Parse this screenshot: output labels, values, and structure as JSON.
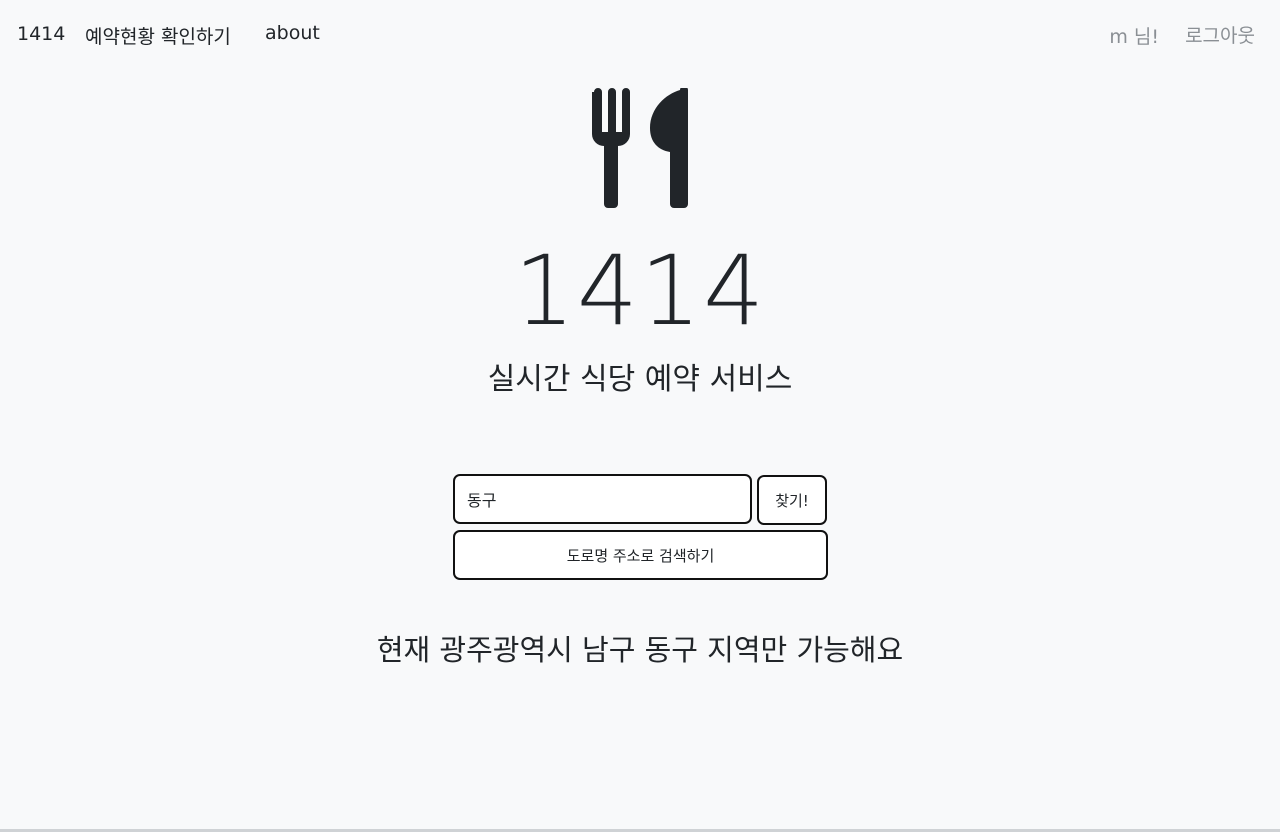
{
  "navbar": {
    "brand": "1414",
    "links": {
      "reservations": "예약현황 확인하기",
      "about": "about"
    },
    "user_greeting": "m 님!",
    "logout": "로그아웃"
  },
  "hero": {
    "icon": "fork-knife-icon",
    "title": "1414",
    "subtitle": "실시간 식당 예약 서비스"
  },
  "search": {
    "value": "동구",
    "button_label": "찾기!",
    "road_address_button": "도로명 주소로 검색하기"
  },
  "notice": "현재 광주광역시 남구 동구 지역만 가능해요",
  "colors": {
    "background": "#f8f9fa",
    "text": "#212529",
    "muted": "#8a8f94",
    "border": "#111111"
  }
}
